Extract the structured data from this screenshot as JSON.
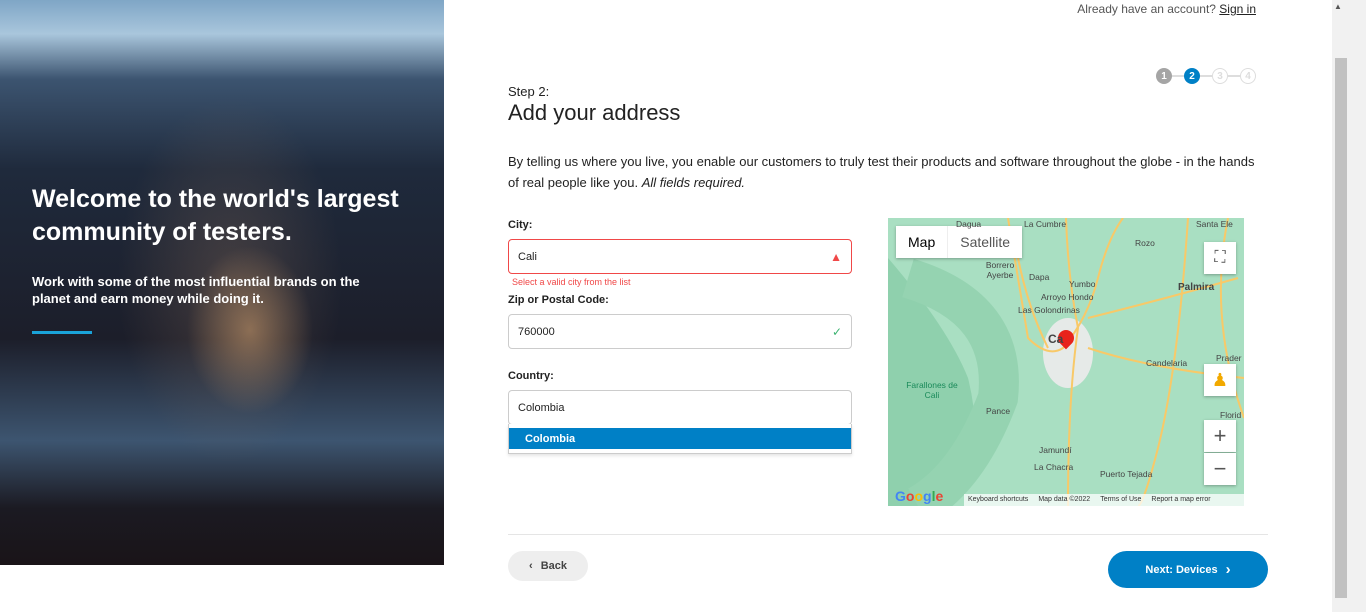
{
  "hero": {
    "title": "Welcome to the world's largest community of testers.",
    "subtitle": "Work with some of the most influential brands on the planet and earn money while doing it."
  },
  "header": {
    "account_prompt": "Already have an account?",
    "signin": "Sign in"
  },
  "steps": [
    "1",
    "2",
    "3",
    "4"
  ],
  "current_step": 2,
  "form": {
    "step_label": "Step 2:",
    "title": "Add your address",
    "description": "By telling us where you live, you enable our customers to truly test their products and software throughout the globe - in the hands of real people like you.",
    "description_note": "All fields required.",
    "city_label": "City:",
    "city_value": "Cali",
    "city_error": "Select a valid city from the list",
    "zip_label": "Zip or Postal Code:",
    "zip_value": "760000",
    "country_label": "Country:",
    "country_value": "Colombia",
    "country_options": [
      "Colombia"
    ]
  },
  "map": {
    "tab_map": "Map",
    "tab_satellite": "Satellite",
    "labels": [
      "Dagua",
      "La Cumbre",
      "Santa Ele",
      "Rozo",
      "Borrero Ayerbe",
      "Dapa",
      "Yumbo",
      "Palmira",
      "Arroyo Hondo",
      "Las Golondrinas",
      "Ca",
      "Candelaria",
      "Prader",
      "Farallones de Cali",
      "Pance",
      "Florid",
      "Jamundí",
      "La Chacra",
      "Puerto Tejada"
    ],
    "footer": [
      "Keyboard shortcuts",
      "Map data ©2022",
      "Terms of Use",
      "Report a map error"
    ],
    "logo": "Google"
  },
  "buttons": {
    "back": "Back",
    "next": "Next: Devices"
  }
}
